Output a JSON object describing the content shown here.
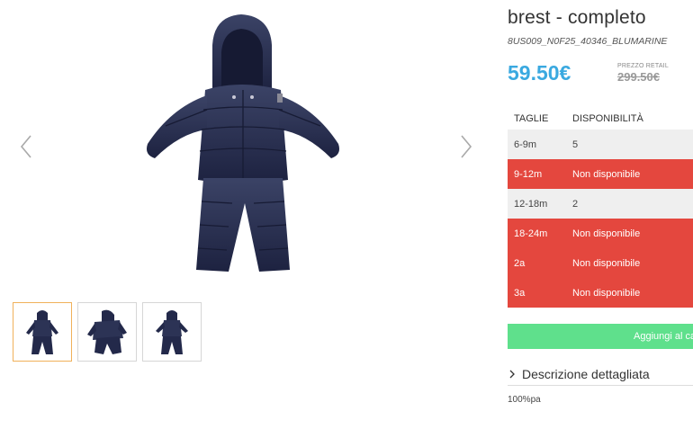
{
  "product": {
    "title": "brest - completo",
    "sku": "8US009_N0F25_40346_BLUMARINE",
    "price": "59.50€",
    "retail_label": "PREZZO RETAIL",
    "retail_price": "299.50€"
  },
  "gallery": {
    "main_image_icon": "snowsuit-image",
    "thumbnails": [
      "snowsuit-front-thumb",
      "snowsuit-side-thumb",
      "snowsuit-back-thumb"
    ],
    "active_thumbnail": 0,
    "colors": {
      "garment": "#23294a",
      "garment_highlight": "#3b4366",
      "active_border": "#f0b15a"
    }
  },
  "sizes": {
    "headers": {
      "size": "TAGLIE",
      "availability": "DISPONIBILITÀ"
    },
    "rows": [
      {
        "size": "6-9m",
        "availability": "5",
        "available": true
      },
      {
        "size": "9-12m",
        "availability": "Non disponibile",
        "available": false
      },
      {
        "size": "12-18m",
        "availability": "2",
        "available": true
      },
      {
        "size": "18-24m",
        "availability": "Non disponibile",
        "available": false
      },
      {
        "size": "2a",
        "availability": "Non disponibile",
        "available": false
      },
      {
        "size": "3a",
        "availability": "Non disponibile",
        "available": false
      }
    ],
    "colors": {
      "available_bg": "#efefef",
      "unavailable_bg": "#e4473e"
    }
  },
  "cart": {
    "label": "Aggiungi al ca",
    "color": "#5fe08c"
  },
  "description": {
    "toggle_label": "Descrizione dettagliata",
    "text": "100%pa"
  },
  "accent_colors": {
    "price": "#3aa9e0"
  }
}
